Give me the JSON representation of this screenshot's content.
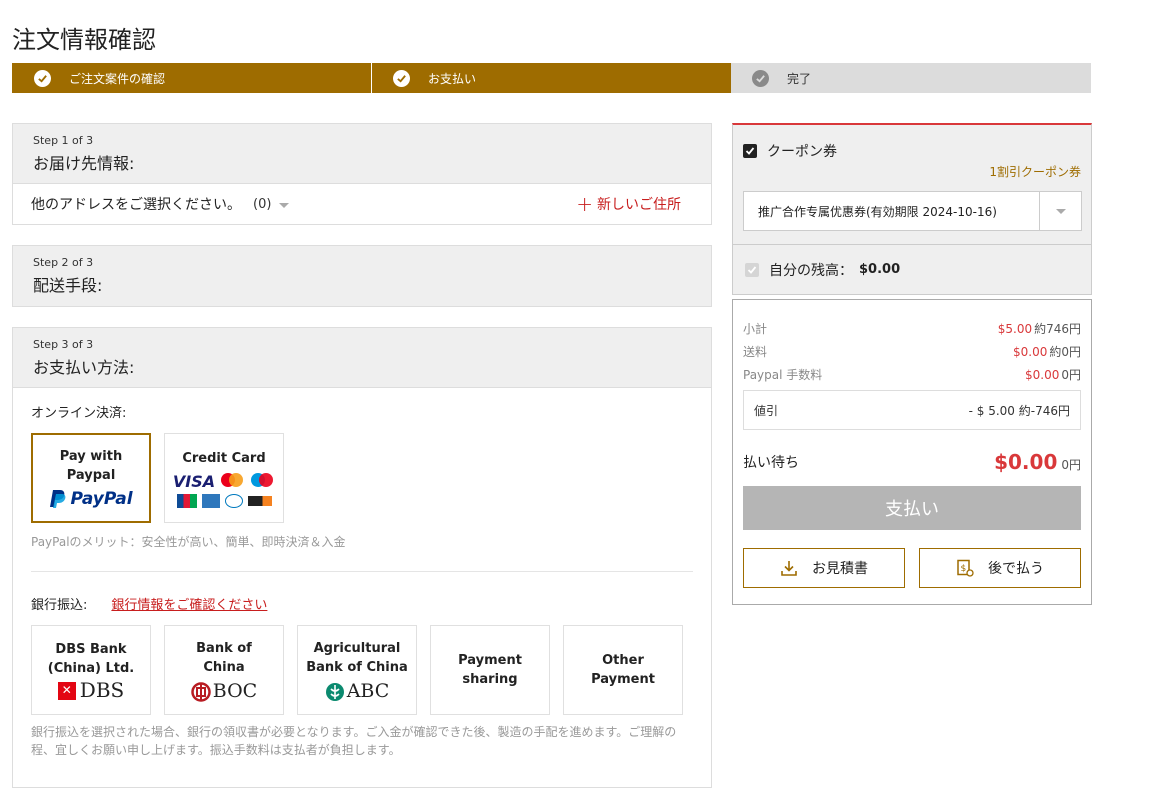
{
  "page": {
    "title": "注文情報確認"
  },
  "progress": [
    {
      "label": "ご注文案件の確認",
      "state": "done"
    },
    {
      "label": "お支払い",
      "state": "done"
    },
    {
      "label": "完了",
      "state": "pending"
    }
  ],
  "step1": {
    "step": "Step 1 of 3",
    "title": "お届け先情報:",
    "address_select": "他のアドレスをご選択ください。",
    "address_count": "(0)",
    "new_address": "新しいご住所"
  },
  "step2": {
    "step": "Step 2 of 3",
    "title": "配送手段:"
  },
  "step3": {
    "step": "Step 3 of 3",
    "title": "お支払い方法:",
    "online_label": "オンライン決済:",
    "online_methods": [
      {
        "label": "Pay with Paypal",
        "logo": "PayPal",
        "selected": true
      },
      {
        "label": "Credit Card",
        "logos": [
          "VISA",
          "mastercard",
          "maestro",
          "JCB",
          "AMERICAN EXPRESS",
          "Diners Club",
          "DISCOVER"
        ]
      }
    ],
    "paypal_note": "PayPalのメリット：安全性が高い、簡単、即時決済＆入金",
    "bank_label": "銀行振込:",
    "bank_link": "銀行情報をご確認ください",
    "banks": [
      {
        "name": "DBS Bank (China) Ltd.",
        "logo": "DBS"
      },
      {
        "name": "Bank of China",
        "logo": "BOC"
      },
      {
        "name": "Agricultural Bank of China",
        "logo": "ABC"
      },
      {
        "name": "Payment sharing"
      },
      {
        "name": "Other Payment"
      }
    ],
    "bank_note": "銀行振込を選択された場合、銀行の領収書が必要となります。ご入金が確認できた後、製造の手配を進めます。ご理解の程、宜しくお願い申し上げます。振込手数料は支払者が負担します。"
  },
  "coupon": {
    "label": "クーポン券",
    "checked": true,
    "count_link": "1割引クーポン券",
    "selected": "推广合作专属优惠券(有効期限 2024-10-16)"
  },
  "balance": {
    "label": "自分の残高：",
    "value": "$0.00"
  },
  "summary": {
    "rows": [
      {
        "label": "小計",
        "usd": "$5.00",
        "jpy": "約746円"
      },
      {
        "label": "送料",
        "usd": "$0.00",
        "jpy": "約0円"
      },
      {
        "label": "Paypal 手数料",
        "usd": "$0.00",
        "jpy": "0円"
      }
    ],
    "discount_label": "値引",
    "discount_value": "- $ 5.00 約-746円",
    "due_label": "払い待ち",
    "due_amount": "$0.00",
    "due_yen": "0円",
    "pay_button": "支払い",
    "quote_button": "お見積書",
    "later_button": "後で払う"
  },
  "colors": {
    "accent": "#9e6c00",
    "red": "#d9383a",
    "disabled": "#b5b5b5"
  }
}
